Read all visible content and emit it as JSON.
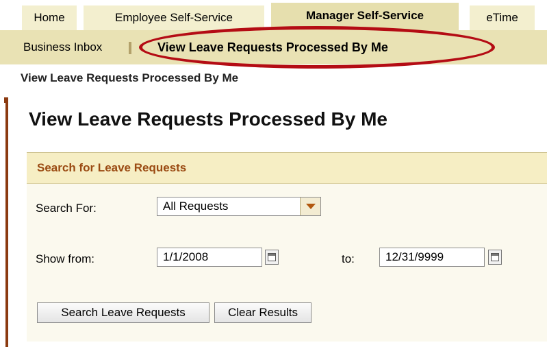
{
  "top_tabs": [
    "Home",
    "Employee Self-Service",
    "Manager Self-Service",
    "eTime"
  ],
  "active_top_tab": "Manager Self-Service",
  "subnav": {
    "items": [
      "Business Inbox",
      "View Leave Requests Processed By Me"
    ],
    "active": "View Leave Requests Processed By Me"
  },
  "breadcrumb": "View Leave Requests Processed By Me",
  "page_title": "View Leave Requests Processed By Me",
  "search_panel": {
    "title": "Search for Leave Requests",
    "search_for_label": "Search For:",
    "search_for_value": "All Requests",
    "show_from_label": "Show from:",
    "from_value": "1/1/2008",
    "to_label": "to:",
    "to_value": "12/31/9999",
    "search_button": "Search Leave Requests",
    "clear_button": "Clear Results"
  },
  "colors": {
    "highlight_oval": "#b40c14",
    "panel_title": "#9a4a12",
    "tab_bg": "#f3efcf",
    "subnav_bg": "#e9e2b4"
  }
}
